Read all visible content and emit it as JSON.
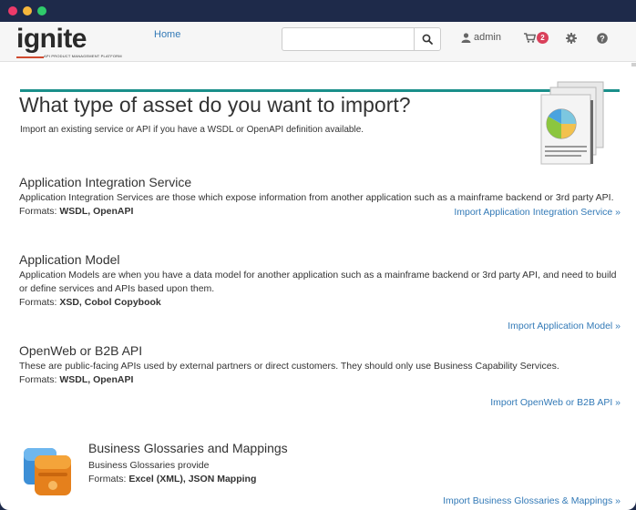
{
  "window": {
    "controls": [
      "close",
      "minimize",
      "maximize"
    ]
  },
  "navbar": {
    "logo_word": "ignite",
    "logo_sub": "API PRODUCT MANAGEMENT PLATFORM",
    "home_label": "Home",
    "search": {
      "value": "",
      "placeholder": ""
    },
    "user_label": "admin",
    "cart_count": "2",
    "icons": [
      "search-icon",
      "user-icon",
      "cart-icon",
      "gear-icon",
      "help-icon"
    ]
  },
  "page": {
    "title": "What type of asset do you want to import?",
    "subtitle": "Import an existing service or API if you have a WSDL or OpenAPI definition available."
  },
  "sections": [
    {
      "title": "Application Integration Service",
      "description": "Application Integration Services are those which expose information from another application such as a mainframe backend or 3rd party API.",
      "formats_label": "Formats:",
      "formats": "WSDL, OpenAPI",
      "link": "Import Application Integration Service »"
    },
    {
      "title": "Application Model",
      "description": "Application Models are when you have a data model for another application such as a mainframe backend or 3rd party API, and need to build or define services and APIs based upon them.",
      "formats_label": "Formats:",
      "formats": "XSD, Cobol Copybook",
      "link": "Import Application Model »"
    },
    {
      "title": "OpenWeb or B2B API",
      "description": "These are public-facing APIs used by external partners or direct customers. They should only use Business Capability Services.",
      "formats_label": "Formats:",
      "formats": "WSDL, OpenAPI",
      "link": "Import OpenWeb or B2B API »"
    },
    {
      "title": "Business Glossaries and Mappings",
      "description": "Business Glossaries provide",
      "formats_label": "Formats:",
      "formats": "Excel (XML), JSON Mapping",
      "link": "Import Business Glossaries & Mappings »"
    }
  ],
  "colors": {
    "accent_teal": "#1a8f8a",
    "link_blue": "#337ab7",
    "badge_red": "#d9405a",
    "frame_navy": "#1e2a4a"
  }
}
